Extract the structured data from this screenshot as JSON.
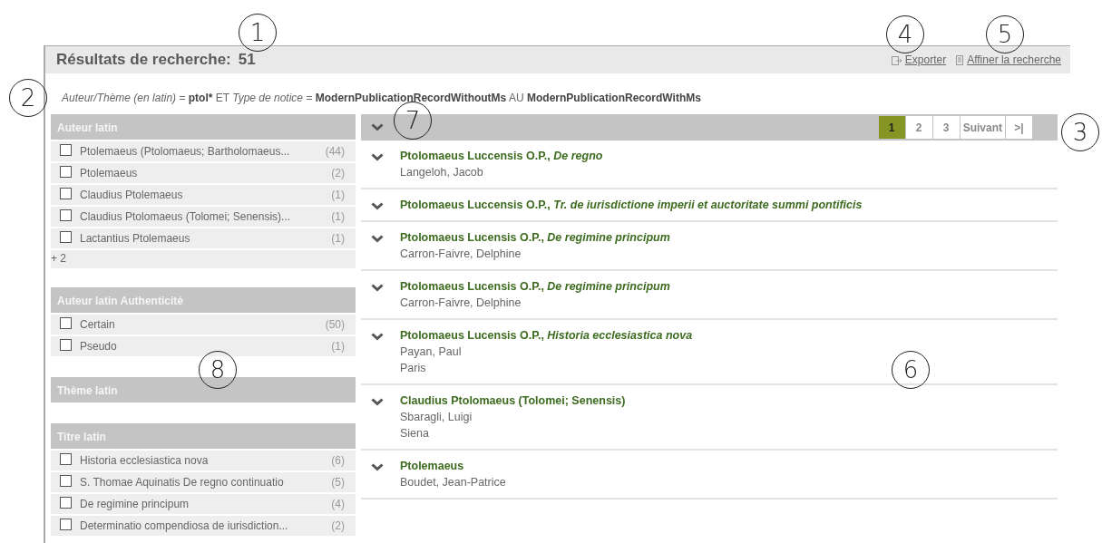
{
  "header": {
    "title": "Résultats de recherche:",
    "count": "51",
    "links": [
      {
        "label": "Exporter",
        "kind": "export"
      },
      {
        "label": "Affiner la recherche",
        "kind": "refine"
      }
    ]
  },
  "query": [
    {
      "field": "Auteur/Thème (en latin)",
      "operator": "=",
      "values": [
        "ptol*"
      ]
    },
    {
      "connector": "ET",
      "field": "Type de notice",
      "operator": "=",
      "values": [
        "ModernPublicationRecordWithoutMs",
        "ModernPublicationRecordWithMs"
      ],
      "joiner": "AU"
    }
  ],
  "facets": [
    {
      "title": "Auteur latin",
      "items": [
        {
          "label": "Ptolemaeus (Ptolomaeus; Bartholomaeus...",
          "count": "(44)",
          "checked": false
        },
        {
          "label": "Ptolemaeus",
          "count": "(2)",
          "checked": false
        },
        {
          "label": "Claudius Ptolemaeus",
          "count": "(1)",
          "checked": false
        },
        {
          "label": "Claudius Ptolomaeus (Tolomei; Senensis)...",
          "count": "(1)",
          "checked": false
        },
        {
          "label": "Lactantius Ptolemaeus",
          "count": "(1)",
          "checked": false
        }
      ],
      "more": "+ 2"
    },
    {
      "title": "Auteur latin Authenticité",
      "items": [
        {
          "label": "Certain",
          "count": "(50)",
          "checked": false
        },
        {
          "label": "Pseudo",
          "count": "(1)",
          "checked": false
        }
      ]
    },
    {
      "title": "Thème latin"
    },
    {
      "title": "Titre latin",
      "items": [
        {
          "label": "Historia ecclesiastica nova",
          "count": "(6)",
          "checked": false
        },
        {
          "label": "S. Thomae Aquinatis De regno continuatio",
          "count": "(5)",
          "checked": false
        },
        {
          "label": "De regimine principum",
          "count": "(4)",
          "checked": false
        },
        {
          "label": "Determinatio compendiosa de iurisdiction...",
          "count": "(2)",
          "checked": false
        }
      ]
    }
  ],
  "pages": [
    {
      "label": "1",
      "selected": true
    },
    {
      "label": "2",
      "selected": false
    },
    {
      "label": "3",
      "selected": false
    },
    {
      "label": "Suivant",
      "selected": false
    },
    {
      "label": ">|",
      "selected": false
    }
  ],
  "results": [
    {
      "title": "Ptolomaeus Luccensis O.P., *De regno*",
      "lines": [
        "Langeloh, Jacob"
      ]
    },
    {
      "title": "Ptolomaeus Luccensis O.P., *Tr. de iurisdictione imperii et auctoritate summi pontificis*"
    },
    {
      "title": "Ptolomaeus Lucensis O.P., *De regimine principum*",
      "lines": [
        "Carron-Faivre, Delphine"
      ]
    },
    {
      "title": "Ptolomaeus Lucensis O.P., *De regimine principum*",
      "lines": [
        "Carron-Faivre, Delphine"
      ]
    },
    {
      "title": "Ptolomaeus Lucensis O.P., *Historia ecclesiastica nova*",
      "lines": [
        "Payan, Paul",
        "Paris"
      ]
    },
    {
      "title": "Claudius Ptolomaeus (Tolomei; Senensis)",
      "lines": [
        "Sbaragli, Luigi",
        "Siena"
      ]
    },
    {
      "title": "Ptolemaeus",
      "lines": [
        "Boudet, Jean-Patrice"
      ]
    }
  ],
  "callouts": [
    "1",
    "2",
    "3",
    "4",
    "5",
    "6",
    "7",
    "8"
  ]
}
